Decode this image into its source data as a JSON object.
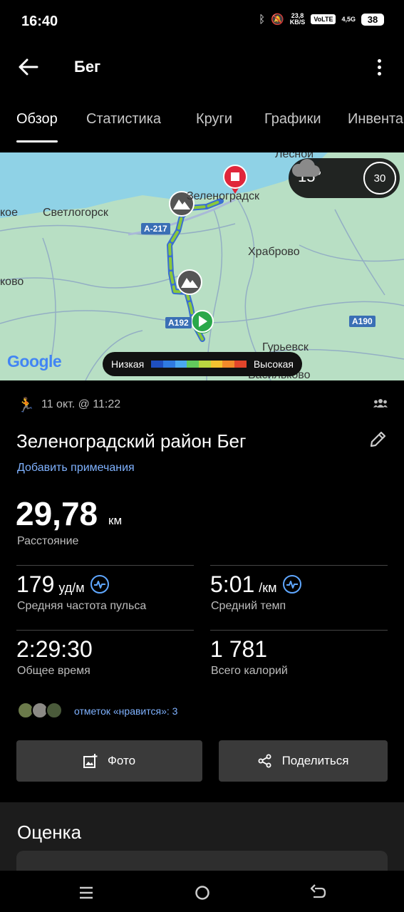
{
  "status": {
    "time": "16:40",
    "net_speed_value": "23,8",
    "net_speed_unit": "KB/S",
    "volte": "VoLTE",
    "signal": "4,5G",
    "battery": "38"
  },
  "app_bar": {
    "title": "Бег"
  },
  "tabs": [
    "Обзор",
    "Статистика",
    "Круги",
    "Графики",
    "Инвента"
  ],
  "map": {
    "places": [
      "Лесной",
      "Зеленоградск",
      "Светлогорск",
      "Храброво",
      "Гурьевск",
      "Васильково",
      "кое",
      "ково"
    ],
    "roads": [
      "A-217",
      "A192",
      "A190"
    ],
    "weather_temp": "15°",
    "timer": "30",
    "google": "Google",
    "legend_low": "Низкая",
    "legend_high": "Высокая",
    "legend_colors": [
      "#1f4fbf",
      "#2f7ae0",
      "#4aa8f0",
      "#62c95c",
      "#b9d640",
      "#f2c230",
      "#f28a2a",
      "#e2452b"
    ]
  },
  "activity": {
    "date": "11 окт. @ 11:22",
    "title": "Зеленоградский район Бег",
    "add_note": "Добавить примечания",
    "distance": "29,78",
    "distance_unit": "км",
    "distance_label": "Расстояние"
  },
  "stats": {
    "hr_value": "179",
    "hr_unit": "уд/м",
    "hr_label": "Средняя частота пульса",
    "pace_value": "5:01",
    "pace_unit": "/км",
    "pace_label": "Средний темп",
    "time_value": "2:29:30",
    "time_label": "Общее время",
    "cal_value": "1 781",
    "cal_label": "Всего калорий"
  },
  "likes": {
    "text": "отметок «нравится»: 3"
  },
  "buttons": {
    "photo": "Фото",
    "share": "Поделиться"
  },
  "rating": {
    "title": "Оценка"
  }
}
